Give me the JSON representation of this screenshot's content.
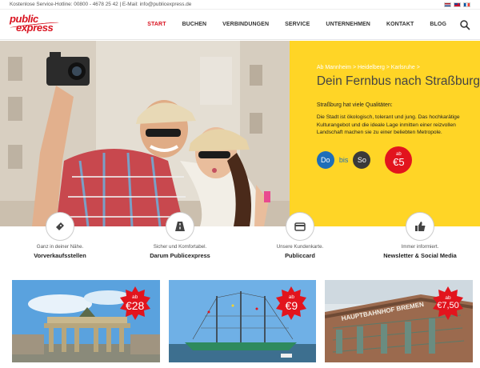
{
  "topbar": {
    "hotline": "Kostenlose Service-Hotline: 00800 - 4678 25 42 | E-Mail: info@publicexpress.de",
    "languages": [
      "nl-flag-icon",
      "en-flag-icon",
      "fr-flag-icon"
    ]
  },
  "header": {
    "logo_line1": "public",
    "logo_line2": "express",
    "nav": [
      "START",
      "BUCHEN",
      "VERBINDUNGEN",
      "SERVICE",
      "UNTERNEHMEN",
      "KONTAKT",
      "BLOG"
    ],
    "active_nav": "START",
    "search_icon": "search-icon"
  },
  "hero": {
    "breadcrumb": "Ab Mannheim > Heidelberg > Karlsruhe >",
    "title": "Dein Fernbus nach Straßburg",
    "subtitle": "Straßburg hat viele Qualitäten:",
    "text": "Die Stadt ist ökologisch, tolerant und jung. Das hochkarätige Kulturangebot und die ideale Lage inmitten einer reizvollen Landschaft machen sie zu einer beliebten Metropole.",
    "day_from": "Do",
    "day_to": "So",
    "bis": "bis",
    "price_prefix": "ab",
    "price": "€5",
    "colors": {
      "panel": "#ffd526",
      "accent_red": "#e2141d",
      "day_blue": "#1e6eb9"
    }
  },
  "features": [
    {
      "small": "Ganz in deiner Nähe.",
      "title": "Vorverkaufsstellen",
      "icon": "ticket-icon"
    },
    {
      "small": "Sicher und Komfortabel.",
      "title": "Darum Publicexpress",
      "icon": "road-icon"
    },
    {
      "small": "Unsere Kundenkarte.",
      "title": "Publiccard",
      "icon": "card-icon"
    },
    {
      "small": "Immer informiert.",
      "title": "Newsletter & Social Media",
      "icon": "thumbs-up-icon"
    }
  ],
  "tiles": [
    {
      "prefix": "ab",
      "price": "€28",
      "scene": "brandenburg-gate"
    },
    {
      "prefix": "ab",
      "price": "€9",
      "scene": "hamburg-harbor"
    },
    {
      "prefix": "ab",
      "price": "€7,50",
      "scene": "bremen-station",
      "sign": "HAUPTBAHNHOF BREMEN"
    }
  ]
}
